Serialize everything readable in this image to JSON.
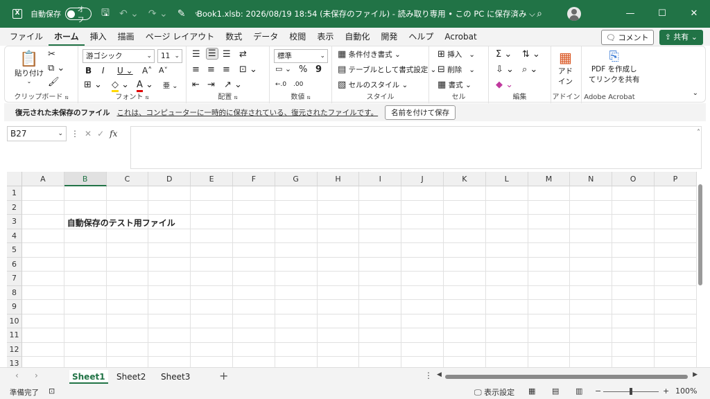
{
  "titlebar": {
    "autosave_label": "自動保存",
    "toggle_label": "オフ",
    "title": "Book1.xlsb: 2026/08/19 18:54 (未保存のファイル) - 読み取り専用 • この PC に保存済み ⌵"
  },
  "tabs": [
    "ファイル",
    "ホーム",
    "挿入",
    "描画",
    "ページ レイアウト",
    "数式",
    "データ",
    "校閲",
    "表示",
    "自動化",
    "開発",
    "ヘルプ",
    "Acrobat"
  ],
  "tab_buttons": {
    "comment": "コメント",
    "share": "共有"
  },
  "ribbon": {
    "clipboard": {
      "paste": "貼り付け",
      "label": "クリップボード"
    },
    "font": {
      "font_name": "游ゴシック",
      "font_size": "11",
      "label": "フォント"
    },
    "alignment": {
      "label": "配置"
    },
    "number": {
      "format": "標準",
      "label": "数値"
    },
    "styles": {
      "conditional": "条件付き書式",
      "table": "テーブルとして書式設定",
      "cell_style": "セルのスタイル",
      "label": "スタイル"
    },
    "cells": {
      "insert": "挿入",
      "delete": "削除",
      "format": "書式",
      "label": "セル"
    },
    "editing": {
      "label": "編集"
    },
    "addins": {
      "addin_line1": "アド",
      "addin_line2": "イン",
      "label": "アドイン"
    },
    "acrobat": {
      "line1": "PDF を作成し",
      "line2": "てリンクを共有",
      "label": "Adobe Acrobat"
    }
  },
  "infobar": {
    "title": "復元された未保存のファイル",
    "message": "これは、コンピューターに一時的に保存されている、復元されたファイルです。",
    "button": "名前を付けて保存"
  },
  "formula": {
    "name_box": "B27",
    "fx": "fx"
  },
  "grid": {
    "columns": [
      "A",
      "B",
      "C",
      "D",
      "E",
      "F",
      "G",
      "H",
      "I",
      "J",
      "K",
      "L",
      "M",
      "N",
      "O",
      "P"
    ],
    "rows": [
      "1",
      "2",
      "3",
      "4",
      "5",
      "6",
      "7",
      "8",
      "9",
      "10",
      "11",
      "12",
      "13"
    ],
    "active_column": "B",
    "cell_B3": "自動保存のテスト用ファイル"
  },
  "sheets": [
    "Sheet1",
    "Sheet2",
    "Sheet3"
  ],
  "status": {
    "ready": "準備完了",
    "display_settings": "表示設定",
    "zoom": "100%"
  }
}
